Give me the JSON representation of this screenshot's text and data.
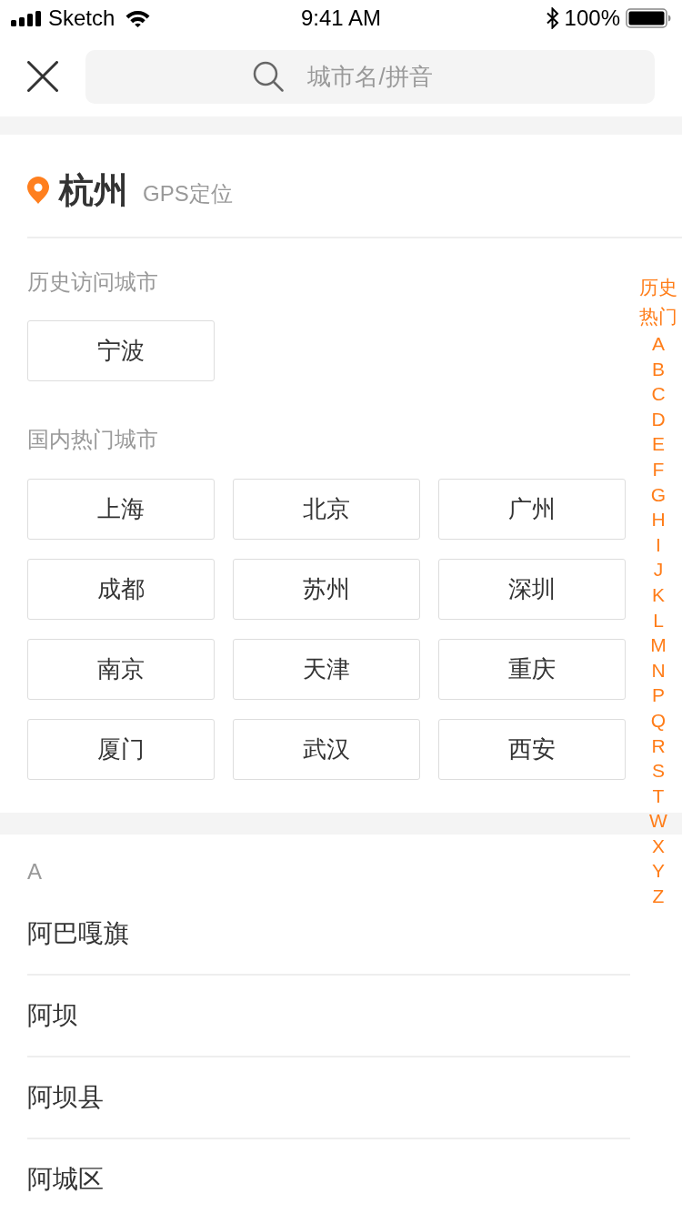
{
  "status_bar": {
    "carrier": "Sketch",
    "time": "9:41 AM",
    "battery": "100%"
  },
  "search": {
    "placeholder": "城市名/拼音"
  },
  "location": {
    "city": "杭州",
    "source": "GPS定位"
  },
  "history": {
    "title": "历史访问城市",
    "cities": [
      "宁波"
    ]
  },
  "hot": {
    "title": "国内热门城市",
    "cities": [
      "上海",
      "北京",
      "广州",
      "成都",
      "苏州",
      "深圳",
      "南京",
      "天津",
      "重庆",
      "厦门",
      "武汉",
      "西安"
    ]
  },
  "sections": [
    {
      "letter": "A",
      "cities": [
        "阿巴嘎旗",
        "阿坝",
        "阿坝县",
        "阿城区"
      ]
    }
  ],
  "index": [
    {
      "label": "历史",
      "kind": "group"
    },
    {
      "label": "热门",
      "kind": "group"
    },
    {
      "label": "A",
      "kind": "letter"
    },
    {
      "label": "B",
      "kind": "letter"
    },
    {
      "label": "C",
      "kind": "letter"
    },
    {
      "label": "D",
      "kind": "letter"
    },
    {
      "label": "E",
      "kind": "letter"
    },
    {
      "label": "F",
      "kind": "letter"
    },
    {
      "label": "G",
      "kind": "letter"
    },
    {
      "label": "H",
      "kind": "letter"
    },
    {
      "label": "I",
      "kind": "letter"
    },
    {
      "label": "J",
      "kind": "letter"
    },
    {
      "label": "K",
      "kind": "letter"
    },
    {
      "label": "L",
      "kind": "letter"
    },
    {
      "label": "M",
      "kind": "letter"
    },
    {
      "label": "N",
      "kind": "letter"
    },
    {
      "label": "P",
      "kind": "letter"
    },
    {
      "label": "Q",
      "kind": "letter"
    },
    {
      "label": "R",
      "kind": "letter"
    },
    {
      "label": "S",
      "kind": "letter"
    },
    {
      "label": "T",
      "kind": "letter"
    },
    {
      "label": "W",
      "kind": "letter"
    },
    {
      "label": "X",
      "kind": "letter"
    },
    {
      "label": "Y",
      "kind": "letter"
    },
    {
      "label": "Z",
      "kind": "letter"
    }
  ]
}
